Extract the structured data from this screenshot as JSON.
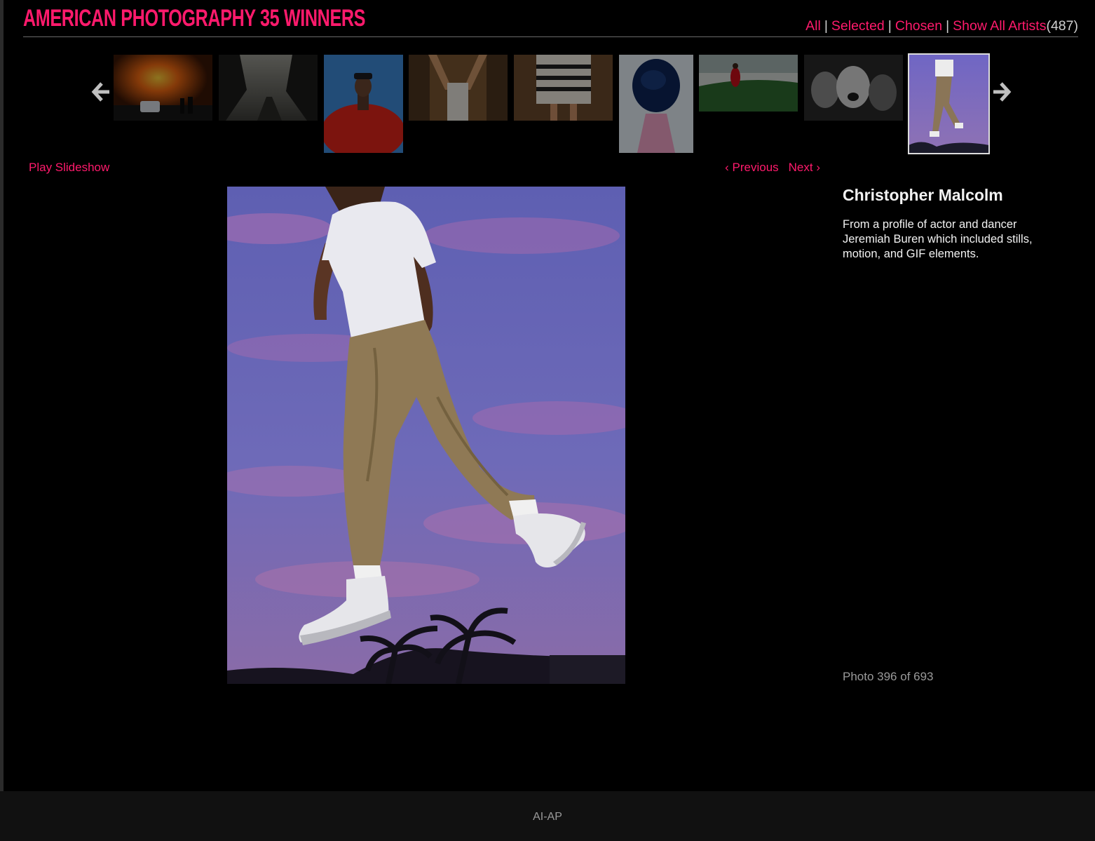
{
  "header": {
    "title": "AMERICAN PHOTOGRAPHY 35 WINNERS",
    "nav": {
      "all": "All",
      "selected": "Selected",
      "chosen": "Chosen",
      "show_all_artists": "Show All Artists",
      "artist_count": "(487)"
    },
    "separator": "|"
  },
  "carousel": {
    "prev_icon": "arrow-left-icon",
    "next_icon": "arrow-right-icon",
    "thumbnail_count": 9,
    "active_index": 9
  },
  "controls": {
    "play_slideshow": "Play Slideshow",
    "previous": "‹ Previous",
    "next": "Next ›"
  },
  "photo": {
    "artist": "Christopher Malcolm",
    "caption": "From a profile of actor and dancer Jeremiah Buren which included stills, motion, and GIF elements.",
    "counter": "Photo 396 of 693"
  },
  "footer": {
    "text": "AI-AP"
  },
  "colors": {
    "accent": "#ff1a6c",
    "background": "#000000",
    "footer_bg": "#111111",
    "muted_text": "#9a9a9a"
  }
}
